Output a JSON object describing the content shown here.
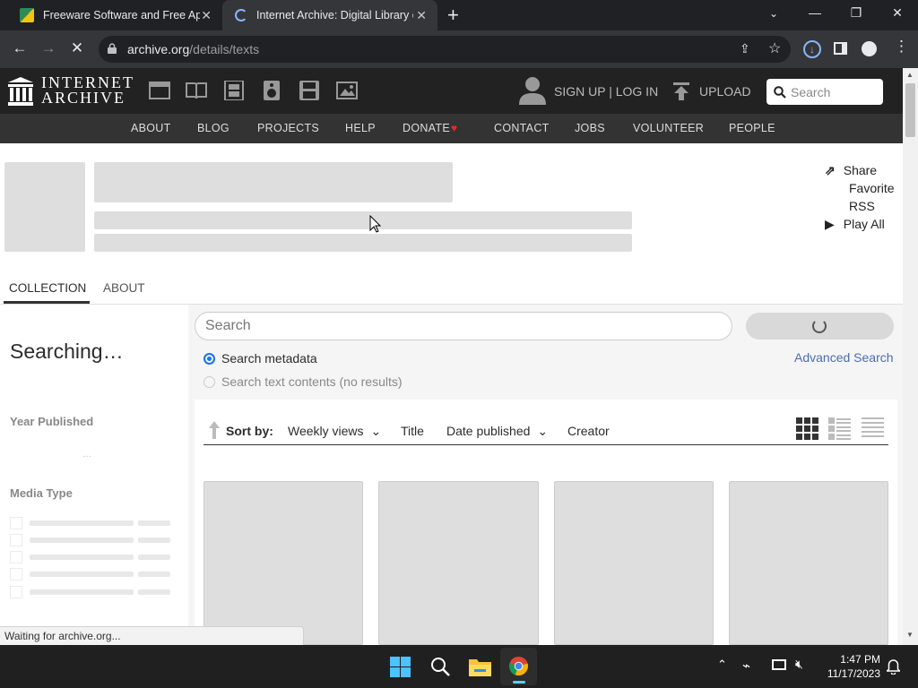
{
  "browser": {
    "tabs": [
      {
        "title": "Freeware Software and Free Apps",
        "active": false
      },
      {
        "title": "Internet Archive: Digital Library of Free",
        "active": true
      }
    ],
    "url_host": "archive.org",
    "url_path": "/details/texts",
    "status_text": "Waiting for archive.org..."
  },
  "ia_header": {
    "logo_line1": "INTERNET",
    "logo_line2": "ARCHIVE",
    "signup_login": "SIGN UP | LOG IN",
    "upload": "UPLOAD",
    "search_placeholder": "Search",
    "nav": [
      "ABOUT",
      "BLOG",
      "PROJECTS",
      "HELP",
      "DONATE",
      "CONTACT",
      "JOBS",
      "VOLUNTEER",
      "PEOPLE"
    ]
  },
  "actions": {
    "share": "Share",
    "favorite": "Favorite",
    "rss": "RSS",
    "play_all": "Play All"
  },
  "tabs": {
    "collection": "COLLECTION",
    "about": "ABOUT"
  },
  "search": {
    "placeholder": "Search",
    "option_metadata": "Search metadata",
    "option_text": "Search text contents (no results)",
    "advanced": "Advanced Search"
  },
  "facets": {
    "searching": "Searching…",
    "year_published": "Year Published",
    "media_type": "Media Type"
  },
  "sortbar": {
    "sort_by": "Sort by:",
    "weekly_views": "Weekly views",
    "title": "Title",
    "date_published": "Date published",
    "creator": "Creator"
  },
  "taskbar": {
    "time": "1:47 PM",
    "date": "11/17/2023"
  },
  "colors": {
    "chrome_dark": "#202124",
    "chrome_tab": "#35363a",
    "ia_header": "#222222",
    "ia_nav": "#333333",
    "link_blue": "#4a6eb0",
    "donate_heart": "#e8282b"
  }
}
